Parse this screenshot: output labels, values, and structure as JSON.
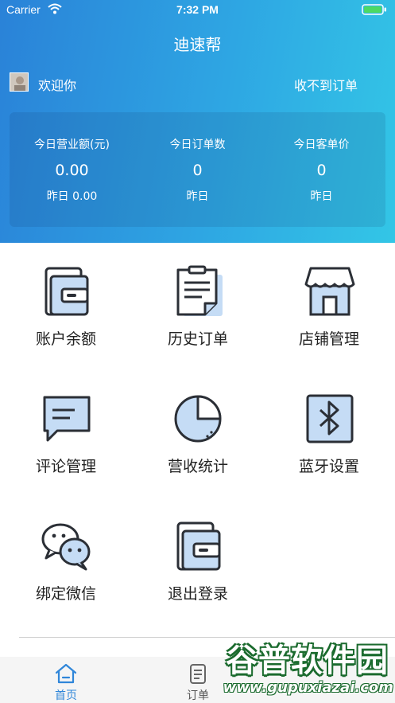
{
  "status_bar": {
    "carrier": "Carrier",
    "time": "7:32 PM"
  },
  "app": {
    "title": "迪速帮"
  },
  "user": {
    "welcome": "欢迎你",
    "no_orders_link": "收不到订单"
  },
  "stats": [
    {
      "label": "今日营业额(元)",
      "value": "0.00",
      "prev": "昨日 0.00"
    },
    {
      "label": "今日订单数",
      "value": "0",
      "prev": "昨日"
    },
    {
      "label": "今日客单价",
      "value": "0",
      "prev": "昨日"
    }
  ],
  "menu": [
    {
      "label": "账户余额",
      "icon": "wallet-icon"
    },
    {
      "label": "历史订单",
      "icon": "clipboard-list-icon"
    },
    {
      "label": "店铺管理",
      "icon": "storefront-icon"
    },
    {
      "label": "评论管理",
      "icon": "comment-bubble-icon"
    },
    {
      "label": "营收统计",
      "icon": "pie-chart-icon"
    },
    {
      "label": "蓝牙设置",
      "icon": "bluetooth-icon"
    },
    {
      "label": "绑定微信",
      "icon": "wechat-icon"
    },
    {
      "label": "退出登录",
      "icon": "logout-wallet-icon"
    }
  ],
  "tabs": [
    {
      "label": "首页",
      "icon": "home-icon",
      "active": true
    },
    {
      "label": "订单",
      "icon": "order-icon",
      "active": false
    }
  ],
  "watermark": {
    "title": "谷普软件园",
    "url": "www.gupuxiazai.com"
  },
  "colors": {
    "accent": "#2f86d9",
    "icon_fill": "#c5dcf5",
    "icon_stroke": "#2b2f36",
    "header_start": "#2a82d8",
    "header_end": "#33c6e6"
  }
}
